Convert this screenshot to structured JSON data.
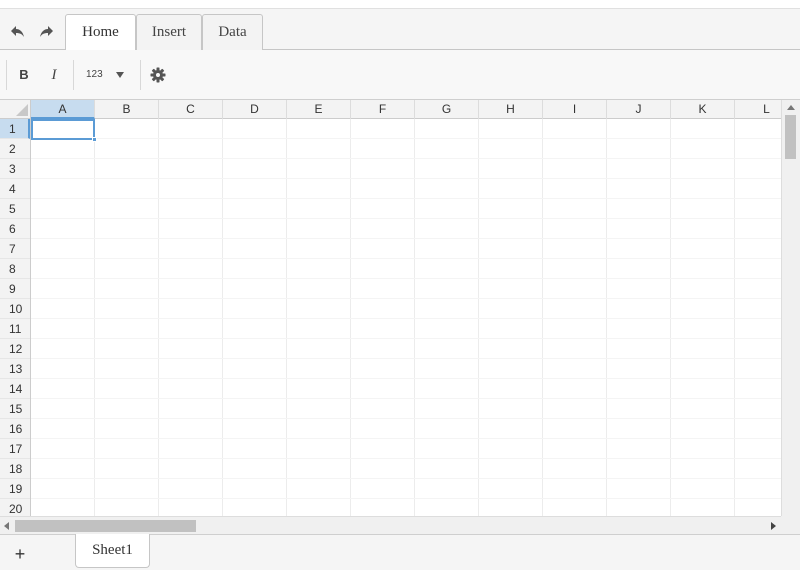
{
  "tabs": [
    {
      "label": "Home",
      "active": true
    },
    {
      "label": "Insert",
      "active": false
    },
    {
      "label": "Data",
      "active": false
    }
  ],
  "toolbar": {
    "bold_label": "B",
    "italic_label": "I",
    "number_format_label": "123",
    "icons": [
      "undo-icon",
      "redo-icon",
      "chevron-down-icon",
      "gear-icon"
    ]
  },
  "grid": {
    "columns": [
      "A",
      "B",
      "C",
      "D",
      "E",
      "F",
      "G",
      "H",
      "I",
      "J",
      "K",
      "L"
    ],
    "rows": [
      "1",
      "2",
      "3",
      "4",
      "5",
      "6",
      "7",
      "8",
      "9",
      "10",
      "11",
      "12",
      "13",
      "14",
      "15",
      "16",
      "17",
      "18",
      "19",
      "20"
    ],
    "selected_column": "A",
    "selected_row": "1",
    "selection_color": "#5b9bd5",
    "header_highlight_color": "#c7dcef"
  },
  "sheets": {
    "add_label": "+",
    "tabs": [
      {
        "label": "Sheet1",
        "active": true
      }
    ]
  }
}
